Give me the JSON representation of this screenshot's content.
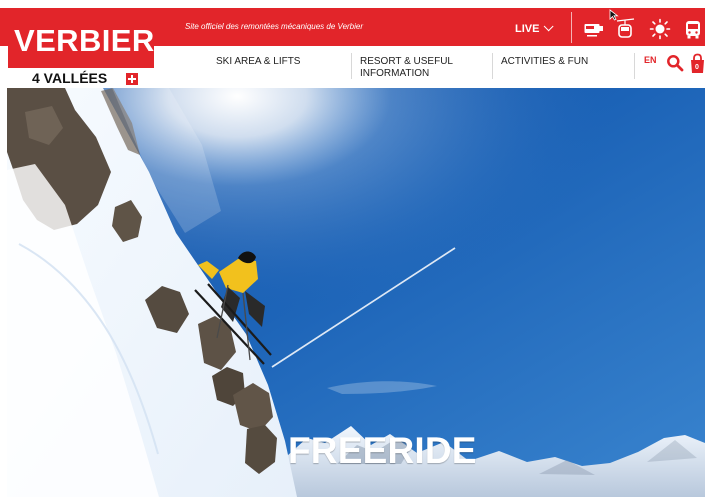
{
  "header": {
    "logo_text": "VERBIER",
    "logo_subtitle": "4 VALLÉES",
    "tagline": "Site officiel des remontées mécaniques de Verbier",
    "live_label": "LIVE",
    "icons": [
      "webcam-icon",
      "gondola-icon",
      "weather-icon",
      "bus-icon"
    ]
  },
  "nav": {
    "items": [
      {
        "label": "SKI AREA & LIFTS"
      },
      {
        "label": "RESORT & USEFUL INFORMATION"
      },
      {
        "label": "ACTIVITIES & FUN"
      }
    ],
    "language": "EN",
    "cart_count": "0"
  },
  "hero": {
    "title": "FREERIDE"
  },
  "colors": {
    "accent": "#e2252a",
    "sky": "#1c63b7",
    "text": "#222222"
  }
}
